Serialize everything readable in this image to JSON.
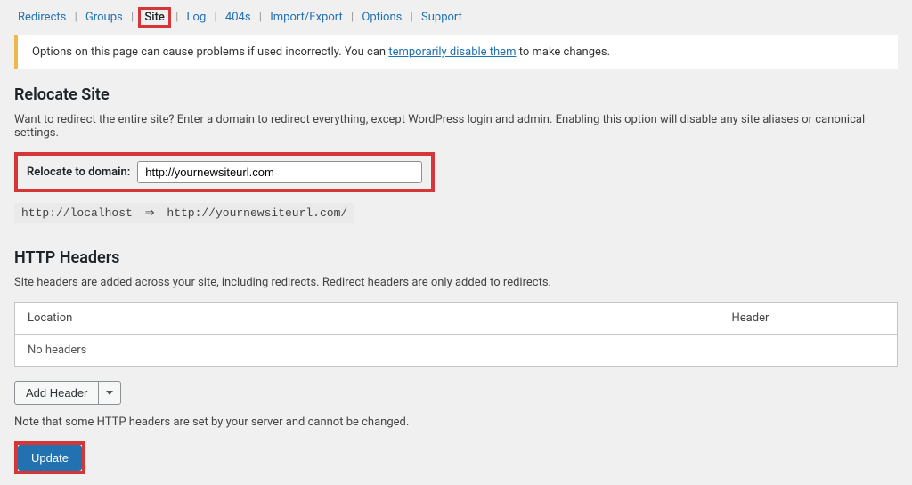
{
  "tabs": {
    "redirects": "Redirects",
    "groups": "Groups",
    "site": "Site",
    "log": "Log",
    "404s": "404s",
    "import_export": "Import/Export",
    "options": "Options",
    "support": "Support"
  },
  "notice": {
    "pre": "Options on this page can cause problems if used incorrectly. You can ",
    "link": "temporarily disable them",
    "post": " to make changes."
  },
  "relocate": {
    "title": "Relocate Site",
    "desc": "Want to redirect the entire site? Enter a domain to redirect everything, except WordPress login and admin. Enabling this option will disable any site aliases or canonical settings.",
    "label": "Relocate to domain:",
    "value": "http://yournewsiteurl.com",
    "map_from": "http://localhost",
    "arrow": "⇒",
    "map_to": "http://yournewsiteurl.com/"
  },
  "headers": {
    "title": "HTTP Headers",
    "desc": "Site headers are added across your site, including redirects. Redirect headers are only added to redirects.",
    "col_location": "Location",
    "col_header": "Header",
    "empty": "No headers",
    "add": "Add Header",
    "note": "Note that some HTTP headers are set by your server and cannot be changed."
  },
  "actions": {
    "update": "Update"
  }
}
